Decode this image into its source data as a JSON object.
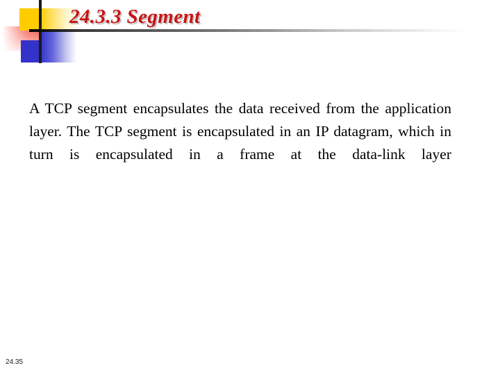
{
  "slide": {
    "title": "24.3.3  Segment",
    "body": "A TCP segment encapsulates the data received from the application layer. The TCP segment is encapsulated in an IP datagram, which in turn is encapsulated in a frame at the data-link layer",
    "footer_page": "24.35"
  },
  "colors": {
    "title_red": "#c81414",
    "motif_yellow": "#ffcc00",
    "motif_blue": "#3333cc",
    "motif_red": "#f4564f",
    "rule_dark": "#000000",
    "body_text": "#000000",
    "background": "#ffffff"
  }
}
